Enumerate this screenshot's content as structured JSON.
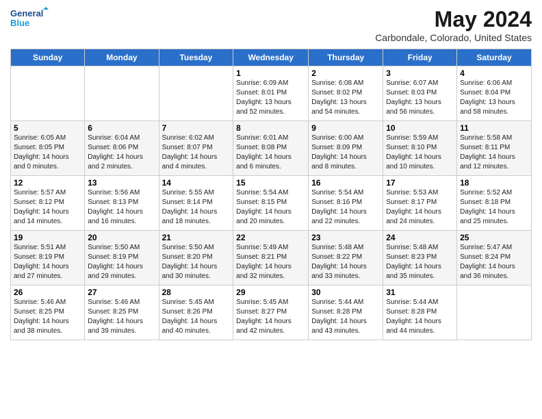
{
  "logo": {
    "line1": "General",
    "line2": "Blue"
  },
  "header": {
    "month": "May 2024",
    "location": "Carbondale, Colorado, United States"
  },
  "weekdays": [
    "Sunday",
    "Monday",
    "Tuesday",
    "Wednesday",
    "Thursday",
    "Friday",
    "Saturday"
  ],
  "weeks": [
    [
      {
        "day": "",
        "info": ""
      },
      {
        "day": "",
        "info": ""
      },
      {
        "day": "",
        "info": ""
      },
      {
        "day": "1",
        "info": "Sunrise: 6:09 AM\nSunset: 8:01 PM\nDaylight: 13 hours\nand 52 minutes."
      },
      {
        "day": "2",
        "info": "Sunrise: 6:08 AM\nSunset: 8:02 PM\nDaylight: 13 hours\nand 54 minutes."
      },
      {
        "day": "3",
        "info": "Sunrise: 6:07 AM\nSunset: 8:03 PM\nDaylight: 13 hours\nand 56 minutes."
      },
      {
        "day": "4",
        "info": "Sunrise: 6:06 AM\nSunset: 8:04 PM\nDaylight: 13 hours\nand 58 minutes."
      }
    ],
    [
      {
        "day": "5",
        "info": "Sunrise: 6:05 AM\nSunset: 8:05 PM\nDaylight: 14 hours\nand 0 minutes."
      },
      {
        "day": "6",
        "info": "Sunrise: 6:04 AM\nSunset: 8:06 PM\nDaylight: 14 hours\nand 2 minutes."
      },
      {
        "day": "7",
        "info": "Sunrise: 6:02 AM\nSunset: 8:07 PM\nDaylight: 14 hours\nand 4 minutes."
      },
      {
        "day": "8",
        "info": "Sunrise: 6:01 AM\nSunset: 8:08 PM\nDaylight: 14 hours\nand 6 minutes."
      },
      {
        "day": "9",
        "info": "Sunrise: 6:00 AM\nSunset: 8:09 PM\nDaylight: 14 hours\nand 8 minutes."
      },
      {
        "day": "10",
        "info": "Sunrise: 5:59 AM\nSunset: 8:10 PM\nDaylight: 14 hours\nand 10 minutes."
      },
      {
        "day": "11",
        "info": "Sunrise: 5:58 AM\nSunset: 8:11 PM\nDaylight: 14 hours\nand 12 minutes."
      }
    ],
    [
      {
        "day": "12",
        "info": "Sunrise: 5:57 AM\nSunset: 8:12 PM\nDaylight: 14 hours\nand 14 minutes."
      },
      {
        "day": "13",
        "info": "Sunrise: 5:56 AM\nSunset: 8:13 PM\nDaylight: 14 hours\nand 16 minutes."
      },
      {
        "day": "14",
        "info": "Sunrise: 5:55 AM\nSunset: 8:14 PM\nDaylight: 14 hours\nand 18 minutes."
      },
      {
        "day": "15",
        "info": "Sunrise: 5:54 AM\nSunset: 8:15 PM\nDaylight: 14 hours\nand 20 minutes."
      },
      {
        "day": "16",
        "info": "Sunrise: 5:54 AM\nSunset: 8:16 PM\nDaylight: 14 hours\nand 22 minutes."
      },
      {
        "day": "17",
        "info": "Sunrise: 5:53 AM\nSunset: 8:17 PM\nDaylight: 14 hours\nand 24 minutes."
      },
      {
        "day": "18",
        "info": "Sunrise: 5:52 AM\nSunset: 8:18 PM\nDaylight: 14 hours\nand 25 minutes."
      }
    ],
    [
      {
        "day": "19",
        "info": "Sunrise: 5:51 AM\nSunset: 8:19 PM\nDaylight: 14 hours\nand 27 minutes."
      },
      {
        "day": "20",
        "info": "Sunrise: 5:50 AM\nSunset: 8:19 PM\nDaylight: 14 hours\nand 29 minutes."
      },
      {
        "day": "21",
        "info": "Sunrise: 5:50 AM\nSunset: 8:20 PM\nDaylight: 14 hours\nand 30 minutes."
      },
      {
        "day": "22",
        "info": "Sunrise: 5:49 AM\nSunset: 8:21 PM\nDaylight: 14 hours\nand 32 minutes."
      },
      {
        "day": "23",
        "info": "Sunrise: 5:48 AM\nSunset: 8:22 PM\nDaylight: 14 hours\nand 33 minutes."
      },
      {
        "day": "24",
        "info": "Sunrise: 5:48 AM\nSunset: 8:23 PM\nDaylight: 14 hours\nand 35 minutes."
      },
      {
        "day": "25",
        "info": "Sunrise: 5:47 AM\nSunset: 8:24 PM\nDaylight: 14 hours\nand 36 minutes."
      }
    ],
    [
      {
        "day": "26",
        "info": "Sunrise: 5:46 AM\nSunset: 8:25 PM\nDaylight: 14 hours\nand 38 minutes."
      },
      {
        "day": "27",
        "info": "Sunrise: 5:46 AM\nSunset: 8:25 PM\nDaylight: 14 hours\nand 39 minutes."
      },
      {
        "day": "28",
        "info": "Sunrise: 5:45 AM\nSunset: 8:26 PM\nDaylight: 14 hours\nand 40 minutes."
      },
      {
        "day": "29",
        "info": "Sunrise: 5:45 AM\nSunset: 8:27 PM\nDaylight: 14 hours\nand 42 minutes."
      },
      {
        "day": "30",
        "info": "Sunrise: 5:44 AM\nSunset: 8:28 PM\nDaylight: 14 hours\nand 43 minutes."
      },
      {
        "day": "31",
        "info": "Sunrise: 5:44 AM\nSunset: 8:28 PM\nDaylight: 14 hours\nand 44 minutes."
      },
      {
        "day": "",
        "info": ""
      }
    ]
  ],
  "colors": {
    "header_bg": "#2a6fc9",
    "header_text": "#ffffff",
    "accent": "#1a4e8c"
  }
}
